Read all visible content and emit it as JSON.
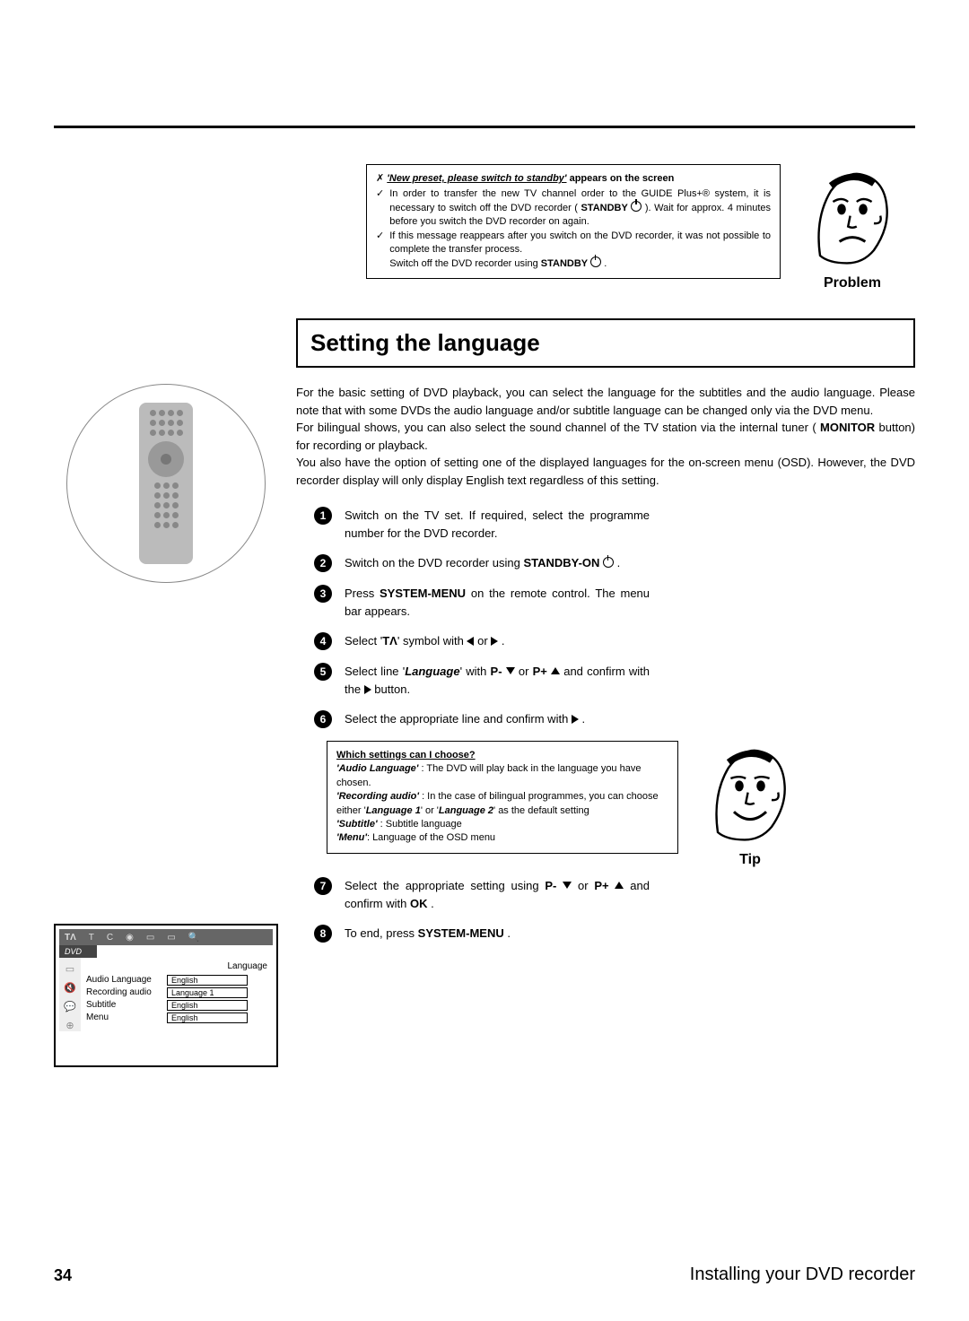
{
  "problem": {
    "cross": "✗",
    "title_a": "'New preset, please switch to standby'",
    "title_b": " appears on the screen",
    "check1": "In order to transfer the new TV channel order to the GUIDE Plus+® system, it is necessary to switch off the DVD recorder ( ",
    "standby_btn": "STANDBY",
    "check1b": " ). Wait for approx. 4 minutes before you switch the DVD recorder on again.",
    "check2": "If this message reappears after you switch on the DVD recorder, it was not possible to complete the transfer process.",
    "check2b": "Switch off the DVD recorder using ",
    "label": "Problem"
  },
  "section": {
    "title": "Setting the language"
  },
  "intro": {
    "p1a": "For the basic setting of DVD playback, you can select the language for the subtitles and the audio language. Please note that with some DVDs the audio language and/or subtitle language can be changed only via the DVD menu.",
    "p2a": "For bilingual shows, you can also select the sound channel of the TV station via the internal tuner ( ",
    "monitor": "MONITOR",
    "p2b": " button) for recording or playback.",
    "p3": "You also have the option of setting one of the displayed languages for the on-screen menu (OSD). However, the DVD recorder display will only display English text regardless of this setting."
  },
  "steps": {
    "s1": "Switch on the TV set. If required, select the programme number for the DVD recorder.",
    "s2a": "Switch on the DVD recorder using ",
    "s2btn": "STANDBY-ON",
    "s3a": "Press ",
    "s3btn": "SYSTEM-MENU",
    "s3b": " on the remote control. The menu bar appears.",
    "s4a": "Select '",
    "s4b": "' symbol with ",
    "s4c": " or ",
    "s5a": "Select line '",
    "s5lang": "Language",
    "s5b": "' with ",
    "s5pm": "P-",
    "s5or": " or ",
    "s5pp": "P+",
    "s5c": " and confirm with the ",
    "s5d": " button.",
    "s6": "Select the appropriate line and confirm with ",
    "s7a": "Select the appropriate setting using ",
    "s7b": " and confirm with ",
    "s7ok": "OK",
    "s8a": "To end, press ",
    "s8btn": "SYSTEM-MENU"
  },
  "tip": {
    "title": "Which settings can I choose?",
    "al_lbl": "'Audio Language'",
    "al_txt": " : The DVD will play back in the language you have chosen.",
    "ra_lbl": "'Recording audio'",
    "ra_txt": " : In the case of bilingual programmes, you can choose either '",
    "l1": "Language 1",
    "ra_or": "' or '",
    "l2": "Language 2",
    "ra_end": "' as the default setting",
    "sub_lbl": "'Subtitle'",
    "sub_txt": " : Subtitle language",
    "menu_lbl": "'Menu'",
    "menu_txt": ": Language of the OSD menu",
    "label": "Tip"
  },
  "osd": {
    "dvd": "DVD",
    "tabs": [
      "T",
      "C",
      "◉",
      "▭",
      "▭",
      "🔍"
    ],
    "heading": "Language",
    "rows": [
      {
        "label": "Audio Language",
        "value": "English"
      },
      {
        "label": "Recording audio",
        "value": "Language 1"
      },
      {
        "label": "Subtitle",
        "value": "English"
      },
      {
        "label": "Menu",
        "value": "English"
      }
    ],
    "side": [
      "▭",
      "🔇",
      "💬",
      "⊕"
    ]
  },
  "footer": {
    "page": "34",
    "title": "Installing your DVD recorder"
  },
  "icons": {
    "check": "✓",
    "toolperson": "TΛ"
  }
}
